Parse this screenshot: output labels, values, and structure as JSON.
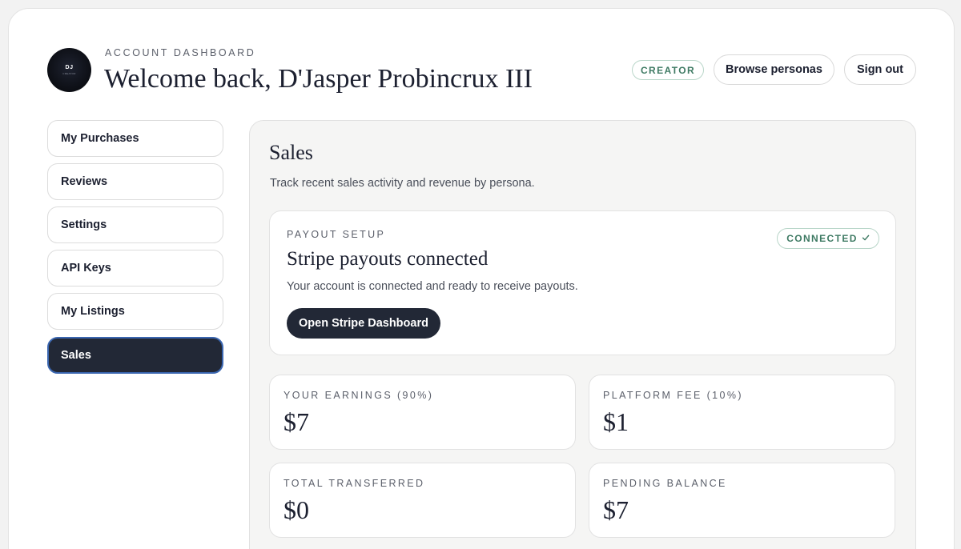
{
  "header": {
    "avatar_initials": "DJ",
    "avatar_tag": "CREATOR",
    "eyebrow": "ACCOUNT DASHBOARD",
    "welcome": "Welcome back, D'Jasper Probincrux III",
    "role_badge": "CREATOR",
    "browse_label": "Browse personas",
    "signout_label": "Sign out"
  },
  "sidebar": {
    "items": [
      {
        "label": "My Purchases",
        "active": false
      },
      {
        "label": "Reviews",
        "active": false
      },
      {
        "label": "Settings",
        "active": false
      },
      {
        "label": "API Keys",
        "active": false
      },
      {
        "label": "My Listings",
        "active": false
      },
      {
        "label": "Sales",
        "active": true
      }
    ]
  },
  "main": {
    "title": "Sales",
    "subtitle": "Track recent sales activity and revenue by persona.",
    "payout": {
      "eyebrow": "PAYOUT SETUP",
      "title": "Stripe payouts connected",
      "description": "Your account is connected and ready to receive payouts.",
      "button_label": "Open Stripe Dashboard",
      "status_badge": "CONNECTED",
      "status_icon": "checkmark-icon"
    },
    "stats": [
      {
        "label": "YOUR EARNINGS (90%)",
        "value": "$7"
      },
      {
        "label": "PLATFORM FEE (10%)",
        "value": "$1"
      },
      {
        "label": "TOTAL TRANSFERRED",
        "value": "$0"
      },
      {
        "label": "PENDING BALANCE",
        "value": "$7"
      }
    ]
  },
  "colors": {
    "accent_dark": "#222836",
    "active_border": "#3a66b0",
    "success_text": "#3e7a63",
    "success_border": "#b9d6c9"
  }
}
